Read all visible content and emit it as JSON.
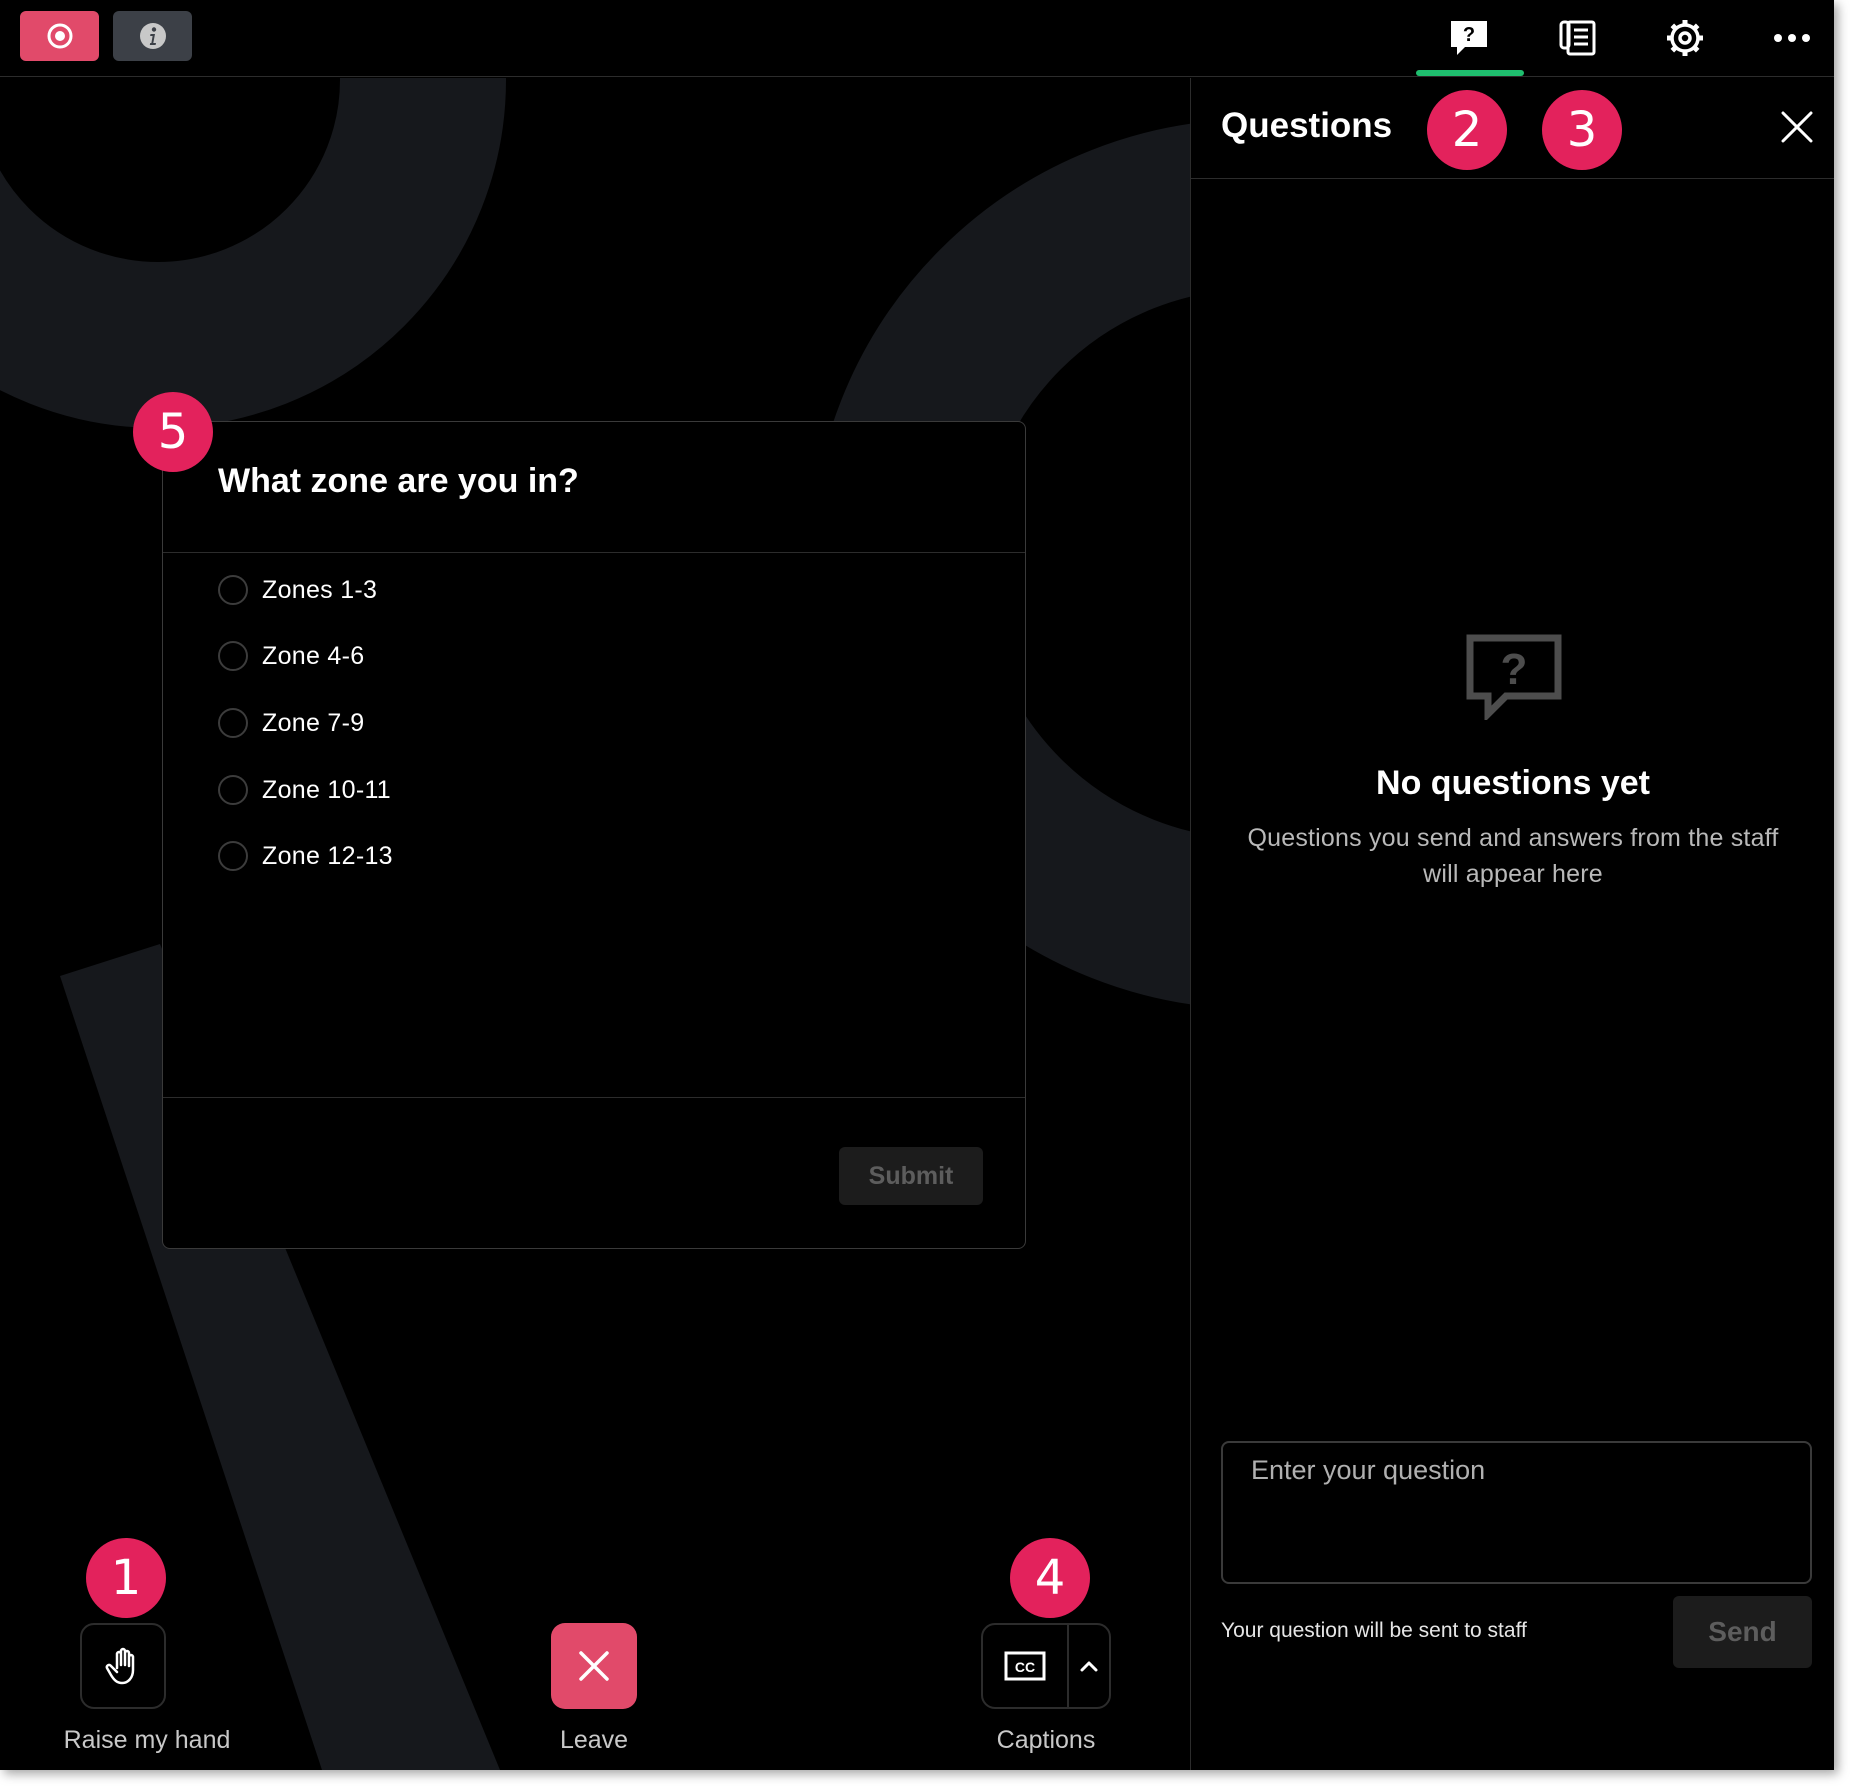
{
  "topbar": {
    "record": {
      "icon": "record-icon",
      "color": "#e14a6a"
    },
    "info": {
      "icon": "info-icon",
      "color": "#3c4047"
    },
    "tabs": [
      {
        "icon": "question-bubble-icon",
        "active": true,
        "accent": "#1fbf6f"
      },
      {
        "icon": "document-list-icon",
        "active": false
      },
      {
        "icon": "gear-icon",
        "active": false
      },
      {
        "icon": "more-horizontal-icon",
        "active": false
      }
    ]
  },
  "poll": {
    "title": "What zone are you in?",
    "options": [
      "Zones 1-3",
      "Zone 4-6",
      "Zone 7-9",
      "Zone 10-11",
      "Zone 12-13"
    ],
    "submit_label": "Submit"
  },
  "controls": {
    "raise_hand_label": "Raise my hand",
    "leave_label": "Leave",
    "captions_label": "Captions",
    "leave_color": "#e14a6a"
  },
  "panel": {
    "title": "Questions",
    "empty_title": "No questions yet",
    "empty_desc": "Questions you send and answers from the staff will appear here",
    "input_placeholder": "Enter your question",
    "hint": "Your question will be sent to staff",
    "send_label": "Send"
  },
  "markers": [
    "1",
    "2",
    "3",
    "4",
    "5"
  ],
  "marker_color": "#e3225c"
}
